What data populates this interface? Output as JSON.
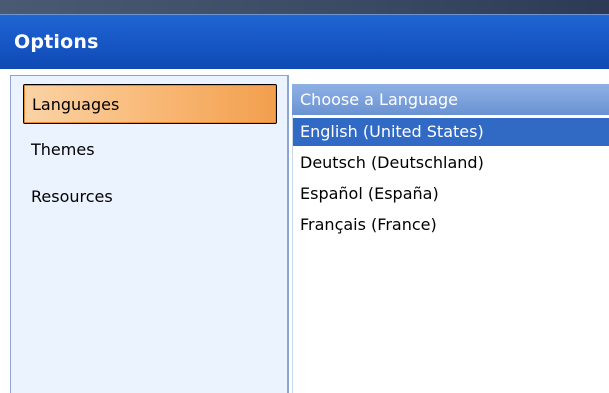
{
  "window": {
    "title": "Options"
  },
  "sidebar": {
    "items": [
      {
        "label": "Languages",
        "selected": true
      },
      {
        "label": "Themes",
        "selected": false
      },
      {
        "label": "Resources",
        "selected": false
      }
    ]
  },
  "language_panel": {
    "header": "Choose a Language",
    "options": [
      {
        "label": "English (United States)",
        "selected": true
      },
      {
        "label": "Deutsch (Deutschland)",
        "selected": false
      },
      {
        "label": "Español (España)",
        "selected": false
      },
      {
        "label": "Français (France)",
        "selected": false
      }
    ]
  },
  "colors": {
    "titlebar": "#1858c7",
    "selection": "#316ac5",
    "sidebar_background": "#eaf3ff",
    "nav_selected_gradient": "#f8b46f"
  }
}
